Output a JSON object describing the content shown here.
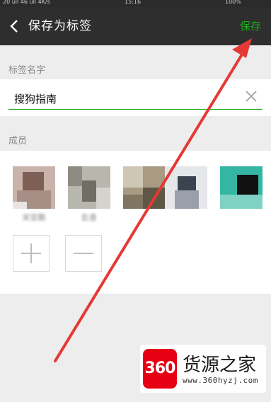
{
  "status_bar": {
    "left_text": "20 ull 46 ull 4K/s",
    "time": "15:16",
    "battery": "100%"
  },
  "nav": {
    "title": "保存为标签",
    "save_label": "保存"
  },
  "tag_name": {
    "section_label": "标签名字",
    "value": "搜狗指南"
  },
  "members": {
    "section_label": "成员",
    "items": [
      {
        "name": "宋亚鹏"
      },
      {
        "name": "彭意"
      },
      {
        "name": ""
      },
      {
        "name": ""
      },
      {
        "name": ""
      }
    ]
  },
  "watermark": {
    "logo": "360",
    "brand": "货源之家",
    "url": "www.360hyzj.com"
  },
  "colors": {
    "accent": "#1aad19",
    "nav_bg": "#2e2e2e",
    "arrow": "#e53935"
  }
}
